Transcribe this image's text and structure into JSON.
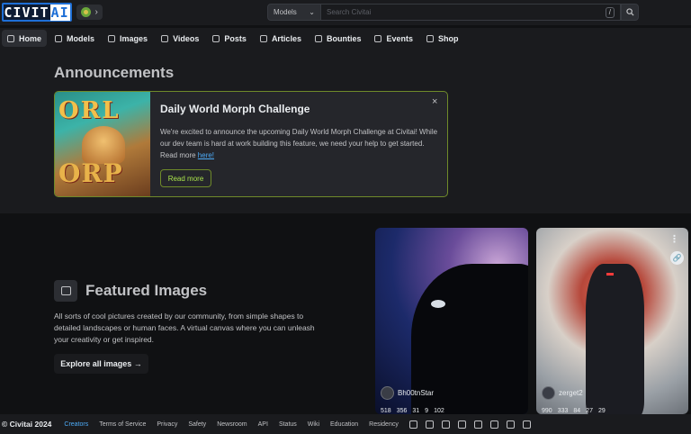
{
  "header": {
    "logo_text": "CIVIT",
    "logo_ai": "AI",
    "search": {
      "category": "Models",
      "placeholder": "Search Civitai",
      "shortcut": "/"
    }
  },
  "nav": {
    "items": [
      {
        "label": "Home",
        "icon": "home-icon"
      },
      {
        "label": "Models",
        "icon": "grid-icon"
      },
      {
        "label": "Images",
        "icon": "photo-icon"
      },
      {
        "label": "Videos",
        "icon": "video-icon"
      },
      {
        "label": "Posts",
        "icon": "posts-icon"
      },
      {
        "label": "Articles",
        "icon": "article-icon"
      },
      {
        "label": "Bounties",
        "icon": "moneybag-icon"
      },
      {
        "label": "Events",
        "icon": "calendar-icon"
      },
      {
        "label": "Shop",
        "icon": "shopping-bag-icon"
      }
    ]
  },
  "announcements": {
    "title": "Announcements",
    "card": {
      "image_text_top": "ORL",
      "image_text_bottom": "ORP",
      "heading": "Daily World Morph Challenge",
      "body": "We're excited to announce the upcoming Daily World Morph Challenge at Civitai! While our dev team is hard at work building this feature, we need your help to get started. Read more ",
      "link": "here!",
      "button": "Read more",
      "close": "×"
    }
  },
  "featured": {
    "title": "Featured Images",
    "description": "All sorts of cool pictures created by our community, from simple shapes to detailed landscapes or human faces. A virtual canvas where you can unleash your creativity or get inspired.",
    "button": "Explore all images →",
    "cards": [
      {
        "user": "Bh00tnStar",
        "stats": [
          "518",
          "356",
          "31",
          "9",
          "102"
        ]
      },
      {
        "user": "zerget2",
        "stats": [
          "990",
          "333",
          "84",
          "27",
          "29"
        ]
      }
    ]
  },
  "footer": {
    "copyright": "© Civitai 2024",
    "links": [
      "Creators",
      "Terms of Service",
      "Privacy",
      "Safety",
      "Newsroom",
      "API",
      "Status",
      "Wiki",
      "Education",
      "Residency"
    ],
    "social_icons": [
      "discord-icon",
      "x-icon",
      "instagram-icon",
      "youtube-icon",
      "tiktok-icon",
      "reddit-icon",
      "github-icon",
      "twitch-icon"
    ]
  }
}
